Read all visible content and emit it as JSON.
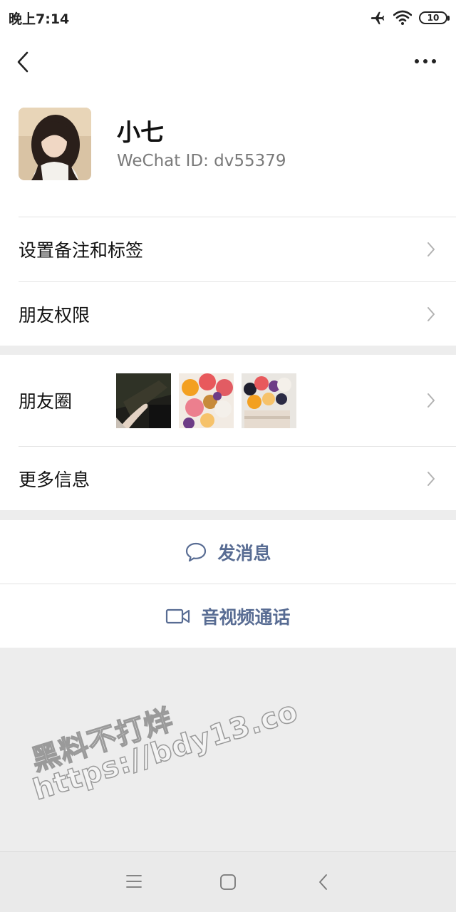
{
  "status_bar": {
    "time": "晚上7:14",
    "battery": "10",
    "icons": [
      "airplane-icon",
      "wifi-icon",
      "battery-icon"
    ]
  },
  "nav": {
    "back_icon": "chevron-left-icon",
    "more_icon": "more-dots-icon"
  },
  "profile": {
    "name": "小七",
    "wechat_id_label": "WeChat ID:",
    "wechat_id": "dv55379"
  },
  "menu": {
    "remark_tags": "设置备注和标签",
    "friend_permissions": "朋友权限",
    "moments": "朋友圈",
    "more_info": "更多信息"
  },
  "actions": {
    "send_message": "发消息",
    "video_call": "音视频通话"
  },
  "watermark": {
    "line1": "黑料不打烊",
    "line2": "https://bdy13.co"
  },
  "colors": {
    "link_blue": "#586c93",
    "background": "#ededed",
    "panel": "#ffffff"
  }
}
